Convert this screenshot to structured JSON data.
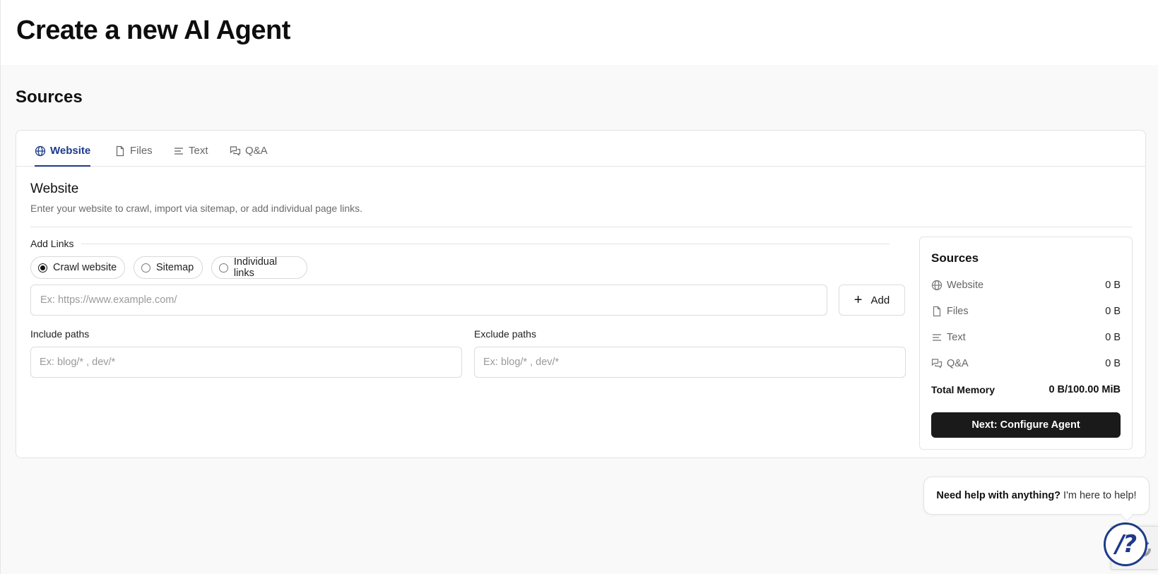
{
  "header": {
    "title": "Create a new AI Agent"
  },
  "section": {
    "title": "Sources"
  },
  "tabs": [
    {
      "label": "Website",
      "icon": "globe-icon",
      "active": true
    },
    {
      "label": "Files",
      "icon": "file-icon",
      "active": false
    },
    {
      "label": "Text",
      "icon": "text-lines-icon",
      "active": false
    },
    {
      "label": "Q&A",
      "icon": "chat-bubbles-icon",
      "active": false
    }
  ],
  "panel": {
    "title": "Website",
    "description": "Enter your website to crawl, import via sitemap, or add individual page links.",
    "add_links_label": "Add Links",
    "modes": [
      {
        "label": "Crawl website",
        "checked": true
      },
      {
        "label": "Sitemap",
        "checked": false
      },
      {
        "label": "Individual links",
        "checked": false
      }
    ],
    "url_input": {
      "value": "",
      "placeholder": "Ex: https://www.example.com/"
    },
    "add_button_label": "Add",
    "include_paths": {
      "label": "Include paths",
      "value": "",
      "placeholder": "Ex: blog/* , dev/*"
    },
    "exclude_paths": {
      "label": "Exclude paths",
      "value": "",
      "placeholder": "Ex: blog/* , dev/*"
    }
  },
  "sources_summary": {
    "title": "Sources",
    "rows": [
      {
        "label": "Website",
        "icon": "globe-icon",
        "value": "0 B"
      },
      {
        "label": "Files",
        "icon": "file-icon",
        "value": "0 B"
      },
      {
        "label": "Text",
        "icon": "text-lines-icon",
        "value": "0 B"
      },
      {
        "label": "Q&A",
        "icon": "chat-bubbles-icon",
        "value": "0 B"
      }
    ],
    "total_label": "Total Memory",
    "total_value": "0 B/100.00 MiB",
    "next_button_label": "Next: Configure Agent"
  },
  "help_widget": {
    "bold_text": "Need help with anything?",
    "text": "I'm here to help!",
    "launcher_glyph": "/?",
    "accent_color": "#1e3a8a"
  },
  "colors": {
    "accent": "#1e3a8a",
    "primary_button": "#1a1a1a",
    "page_background": "#f9f9f9"
  }
}
